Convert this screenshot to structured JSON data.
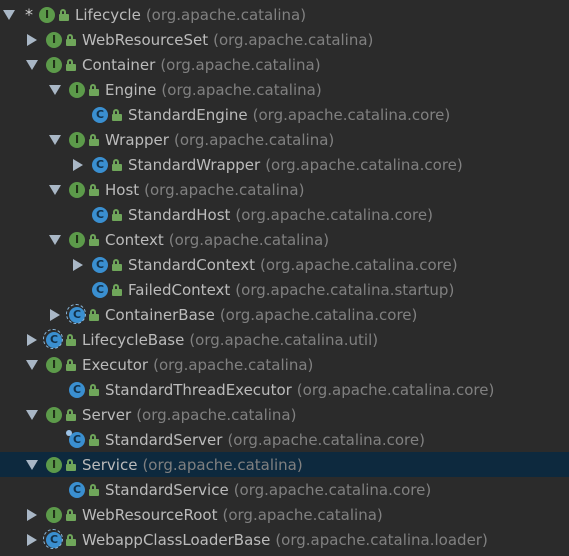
{
  "tree": [
    {
      "name": "Lifecycle",
      "pkg": "(org.apache.catalina)",
      "kind": "interface",
      "arrow": "down",
      "star": "*",
      "depth": 0
    },
    {
      "name": "WebResourceSet",
      "pkg": "(org.apache.catalina)",
      "kind": "interface",
      "arrow": "right",
      "depth": 1
    },
    {
      "name": "Container",
      "pkg": "(org.apache.catalina)",
      "kind": "interface",
      "arrow": "down",
      "depth": 1
    },
    {
      "name": "Engine",
      "pkg": "(org.apache.catalina)",
      "kind": "interface",
      "arrow": "down",
      "depth": 2
    },
    {
      "name": "StandardEngine",
      "pkg": "(org.apache.catalina.core)",
      "kind": "class",
      "arrow": "none",
      "depth": 3
    },
    {
      "name": "Wrapper",
      "pkg": "(org.apache.catalina)",
      "kind": "interface",
      "arrow": "down",
      "depth": 2
    },
    {
      "name": "StandardWrapper",
      "pkg": "(org.apache.catalina.core)",
      "kind": "class",
      "arrow": "right",
      "depth": 3
    },
    {
      "name": "Host",
      "pkg": "(org.apache.catalina)",
      "kind": "interface",
      "arrow": "down",
      "depth": 2
    },
    {
      "name": "StandardHost",
      "pkg": "(org.apache.catalina.core)",
      "kind": "class",
      "arrow": "none",
      "depth": 3
    },
    {
      "name": "Context",
      "pkg": "(org.apache.catalina)",
      "kind": "interface",
      "arrow": "down",
      "depth": 2
    },
    {
      "name": "StandardContext",
      "pkg": "(org.apache.catalina.core)",
      "kind": "class",
      "arrow": "right",
      "depth": 3
    },
    {
      "name": "FailedContext",
      "pkg": "(org.apache.catalina.startup)",
      "kind": "class",
      "arrow": "none",
      "depth": 3
    },
    {
      "name": "ContainerBase",
      "pkg": "(org.apache.catalina.core)",
      "kind": "abstract",
      "arrow": "right",
      "depth": 2
    },
    {
      "name": "LifecycleBase",
      "pkg": "(org.apache.catalina.util)",
      "kind": "abstract",
      "arrow": "right",
      "depth": 1
    },
    {
      "name": "Executor",
      "pkg": "(org.apache.catalina)",
      "kind": "interface",
      "arrow": "down",
      "depth": 1
    },
    {
      "name": "StandardThreadExecutor",
      "pkg": "(org.apache.catalina.core)",
      "kind": "class",
      "arrow": "none",
      "depth": 2
    },
    {
      "name": "Server",
      "pkg": "(org.apache.catalina)",
      "kind": "interface",
      "arrow": "down",
      "depth": 1
    },
    {
      "name": "StandardServer",
      "pkg": "(org.apache.catalina.core)",
      "kind": "class-exec",
      "arrow": "none",
      "depth": 2
    },
    {
      "name": "Service",
      "pkg": "(org.apache.catalina)",
      "kind": "interface",
      "arrow": "down",
      "depth": 1,
      "selected": true
    },
    {
      "name": "StandardService",
      "pkg": "(org.apache.catalina.core)",
      "kind": "class",
      "arrow": "none",
      "depth": 2
    },
    {
      "name": "WebResourceRoot",
      "pkg": "(org.apache.catalina)",
      "kind": "interface",
      "arrow": "right",
      "depth": 1
    },
    {
      "name": "WebappClassLoaderBase",
      "pkg": "(org.apache.catalina.loader)",
      "kind": "abstract",
      "arrow": "right",
      "depth": 1
    }
  ],
  "badge_letters": {
    "interface": "I",
    "class": "C",
    "abstract": "C",
    "class-exec": "C"
  },
  "colors": {
    "background": "#2b2b2b",
    "selection": "#0d293e",
    "interface": "#5c9a4a",
    "class": "#3a8fd0"
  }
}
